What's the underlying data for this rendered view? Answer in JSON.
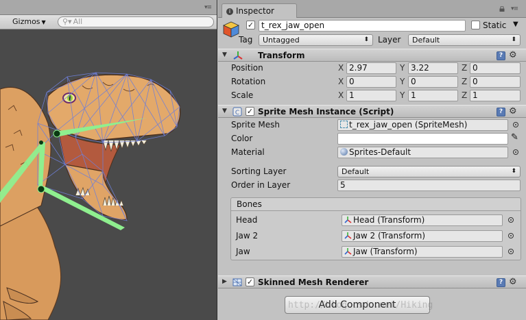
{
  "scene": {
    "toolbar": {
      "gizmos_label": "Gizmos",
      "search_placeholder": "All"
    }
  },
  "inspector": {
    "tab_label": "Inspector",
    "object": {
      "name": "t_rex_jaw_open",
      "active": true,
      "static_label": "Static",
      "static_checked": false,
      "tag_label": "Tag",
      "tag_value": "Untagged",
      "layer_label": "Layer",
      "layer_value": "Default"
    },
    "transform": {
      "title": "Transform",
      "position_label": "Position",
      "rotation_label": "Rotation",
      "scale_label": "Scale",
      "position": {
        "x": "2.97",
        "y": "3.22",
        "z": "0"
      },
      "rotation": {
        "x": "0",
        "y": "0",
        "z": "0"
      },
      "scale": {
        "x": "1",
        "y": "1",
        "z": "1"
      },
      "axis_x": "X",
      "axis_y": "Y",
      "axis_z": "Z"
    },
    "sprite_mesh_instance": {
      "title": "Sprite Mesh Instance (Script)",
      "enabled": true,
      "sprite_mesh_label": "Sprite Mesh",
      "sprite_mesh_value": "t_rex_jaw_open (SpriteMesh)",
      "color_label": "Color",
      "material_label": "Material",
      "material_value": "Sprites-Default",
      "sorting_layer_label": "Sorting Layer",
      "sorting_layer_value": "Default",
      "order_label": "Order in Layer",
      "order_value": "5",
      "bones": {
        "header": "Bones",
        "items": [
          {
            "label": "Head",
            "value": "Head (Transform)"
          },
          {
            "label": "Jaw 2",
            "value": "Jaw 2 (Transform)"
          },
          {
            "label": "Jaw",
            "value": "Jaw (Transform)"
          }
        ]
      }
    },
    "skinned_mesh_renderer": {
      "title": "Skinned Mesh Renderer",
      "enabled": true
    },
    "add_component_label": "Add Component",
    "watermark": "http://blog.csdn.net/Hiking"
  },
  "colors": {
    "bone_green": "#8fef8f",
    "mesh_blue": "#6f7fd8",
    "skin_orange": "#e3a96a",
    "help_blue": "#5a7bb4"
  }
}
